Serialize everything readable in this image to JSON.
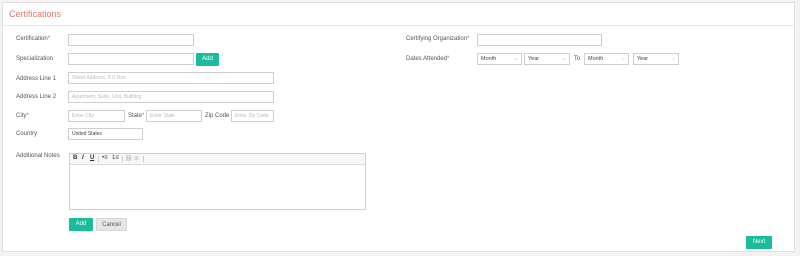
{
  "panel": {
    "title": "Certifications"
  },
  "labels": {
    "certification": "Certification",
    "specialization": "Specialization",
    "address1": "Address Line 1",
    "address2": "Address Line 2",
    "city": "City",
    "state": "State",
    "zip": "Zip Code",
    "country": "Country",
    "notes": "Additional Notes",
    "certifying_org": "Certifying Organization",
    "dates_attended": "Dates Attended",
    "to": "To"
  },
  "required_marker": "*",
  "fields": {
    "certification": {
      "value": ""
    },
    "specialization": {
      "value": ""
    },
    "address1": {
      "placeholder": "Street Address, P.O Box"
    },
    "address2": {
      "placeholder": "Apartment, Suite, Unit, Building"
    },
    "city": {
      "placeholder": "Enter City"
    },
    "state": {
      "placeholder": "Enter State"
    },
    "zip": {
      "placeholder": "Enter Zip Code"
    },
    "country": {
      "value": "United States"
    },
    "certifying_org": {
      "value": ""
    }
  },
  "dates": {
    "from_month": "Month",
    "from_year": "Year",
    "to_month": "Month",
    "to_year": "Year"
  },
  "editor": {
    "toolbar": [
      "B",
      "I",
      "U",
      "•≡",
      "1≡",
      "⛓",
      "⊘"
    ]
  },
  "buttons": {
    "add_specialization": "Add",
    "add": "Add",
    "cancel": "Cancel",
    "next": "Next"
  },
  "colors": {
    "accent": "#1abc9c",
    "title": "#e8786b",
    "required": "#d9534f"
  }
}
